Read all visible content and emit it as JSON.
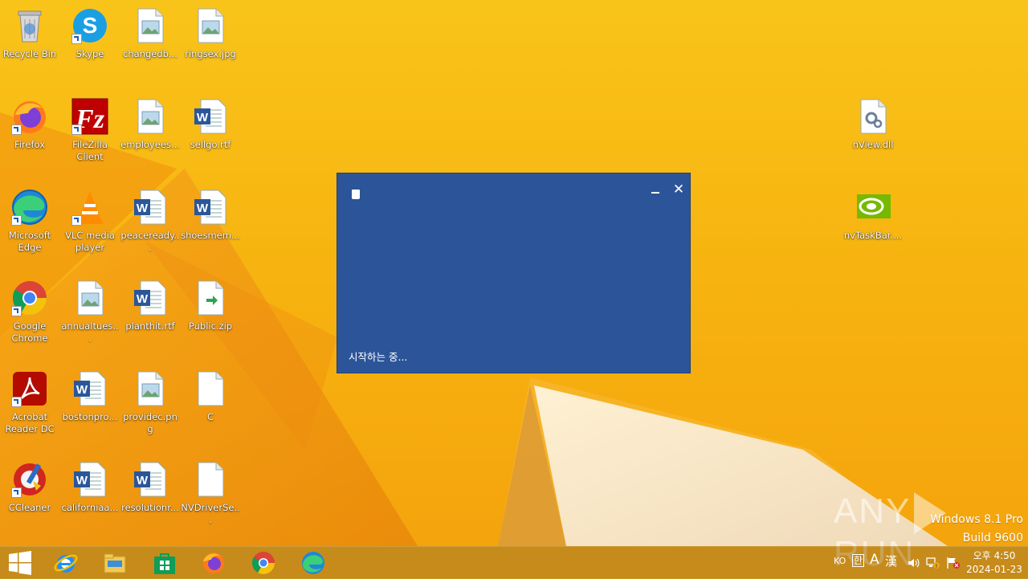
{
  "desktop": {
    "icons": {
      "recycle_bin": "Recycle Bin",
      "skype": "Skype",
      "changedb": "changedb...",
      "ringsex": "ringsex.jpg",
      "firefox": "Firefox",
      "filezilla": "FileZilla Client",
      "employees": "employees...",
      "sellgo": "sellgo.rtf",
      "nview": "nView.dll",
      "edge": "Microsoft Edge",
      "vlc": "VLC media player",
      "peaceready": "peaceready...",
      "shoesmem": "shoesmem...",
      "nvtaskbar": "nvTaskBar....",
      "chrome": "Google Chrome",
      "annualtues": "annualtues...",
      "planthit": "planthit.rtf",
      "publiczip": "Public.zip",
      "acrobat": "Acrobat Reader DC",
      "bostonpro": "bostonpro...",
      "providec": "providec.png",
      "c_file": "C",
      "ccleaner": "CCleaner",
      "californiaa": "californiaa...",
      "resolutionr": "resolutionr...",
      "nvdriverse": "NVDriverSe..."
    }
  },
  "dialog": {
    "status": "시작하는 중...",
    "close_glyph": "✕",
    "bg_color": "#2c5599"
  },
  "watermark": {
    "left": "ANY",
    "right": "RUN"
  },
  "os": {
    "line1": "Windows 8.1 Pro",
    "line2": "Build 9600"
  },
  "taskbar": {
    "apps": [
      "start-icon",
      "internet-explorer-icon",
      "file-explorer-icon",
      "store-icon",
      "firefox-icon",
      "chrome-icon",
      "edge-icon"
    ],
    "tray": {
      "lang": "KO",
      "ime_han": "한",
      "ime_a": "A",
      "ime_hanja": "漢"
    },
    "clock_time": "오후 4:50",
    "clock_date": "2024-01-23"
  }
}
